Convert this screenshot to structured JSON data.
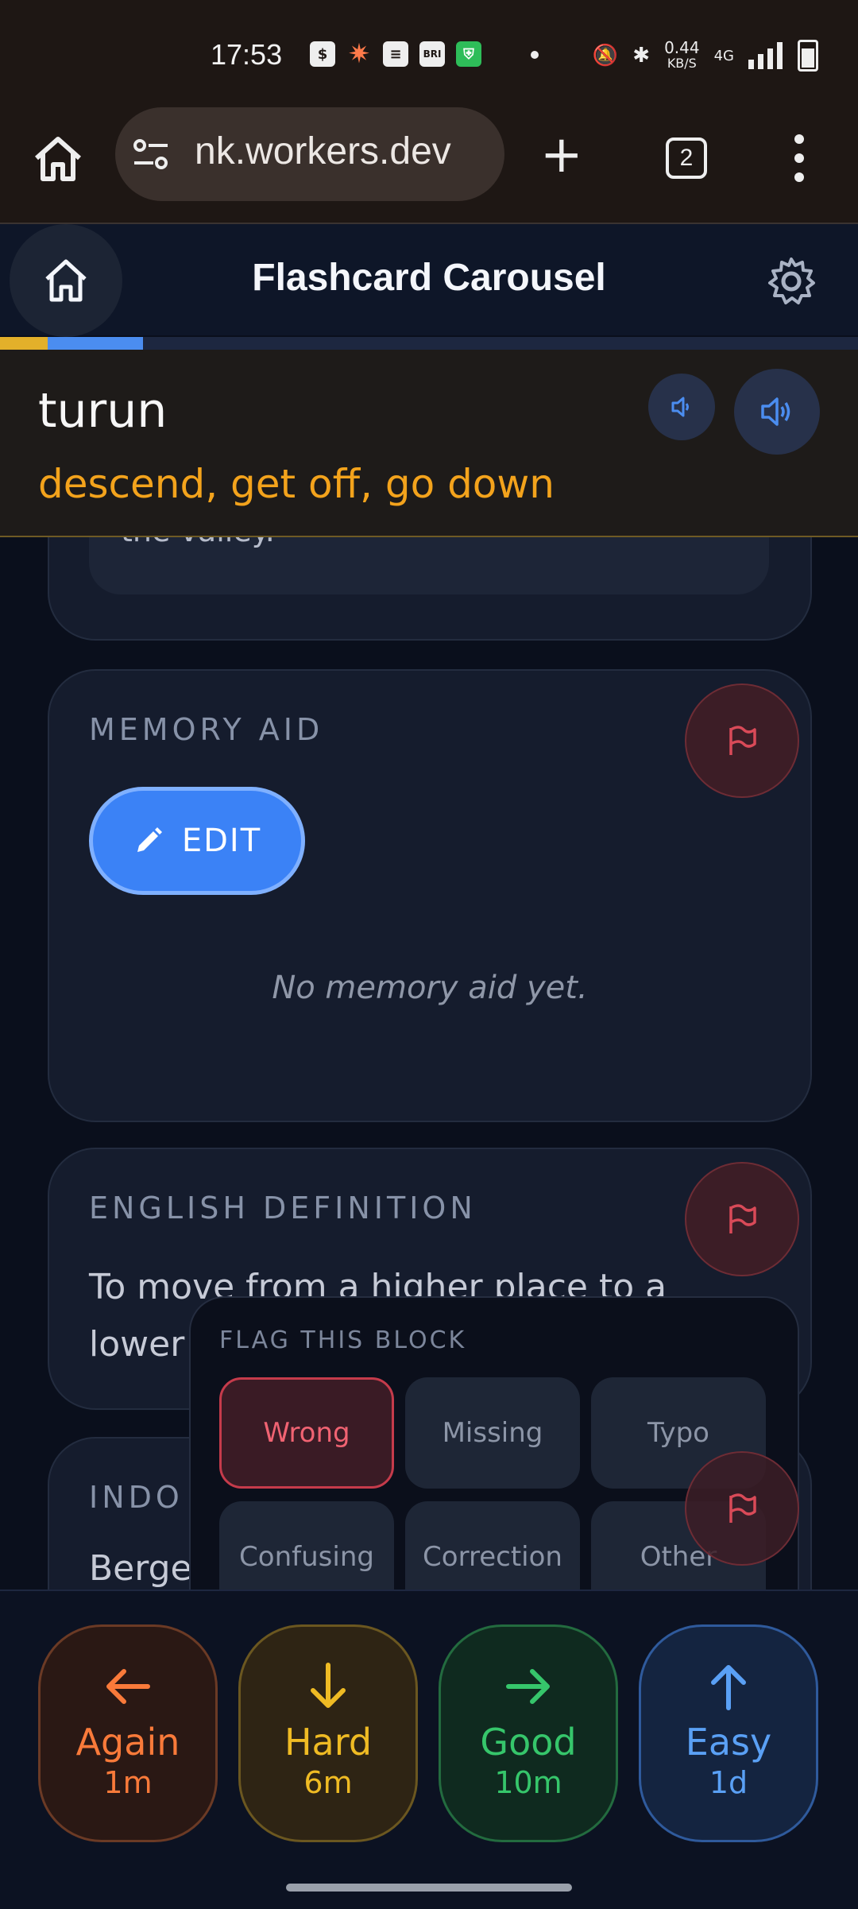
{
  "status_bar": {
    "time": "17:53",
    "notification_icons": [
      "shopping-bag-icon",
      "sparkle-icon",
      "message-icon",
      "bri-mo-app-icon",
      "shield-icon"
    ],
    "bri_label": "BRI",
    "network_speed_value": "0.44",
    "network_speed_unit": "KB/S",
    "network_type": "4G",
    "status_icons": [
      "mute-icon",
      "bluetooth-icon",
      "signal-icon",
      "battery-icon"
    ]
  },
  "browser": {
    "url": "nk.workers.dev",
    "tab_count": "2"
  },
  "app": {
    "title": "Flashcard Carousel",
    "progress_fraction": 0.11
  },
  "word": {
    "term": "turun",
    "meaning": "descend, get off, go down"
  },
  "cards": {
    "example_tail": "the valley.",
    "memory_aid": {
      "label": "MEMORY AID",
      "edit_label": "EDIT",
      "empty_text": "No memory aid yet."
    },
    "english_definition": {
      "label": "ENGLISH DEFINITION",
      "text_line1": "To move from a higher place to a",
      "text_line2": "lower"
    },
    "indonesian": {
      "label_visible": "INDO",
      "text_visible": "Berge"
    }
  },
  "flag_popup": {
    "title": "FLAG THIS BLOCK",
    "options": [
      "Wrong",
      "Missing",
      "Typo",
      "Confusing",
      "Correction",
      "Other"
    ],
    "selected": "Wrong"
  },
  "ratings": [
    {
      "label": "Again",
      "interval": "1m",
      "color": "#f97a3a"
    },
    {
      "label": "Hard",
      "interval": "6m",
      "color": "#efbb24"
    },
    {
      "label": "Good",
      "interval": "10m",
      "color": "#36c66b"
    },
    {
      "label": "Easy",
      "interval": "1d",
      "color": "#5aa0f5"
    }
  ]
}
